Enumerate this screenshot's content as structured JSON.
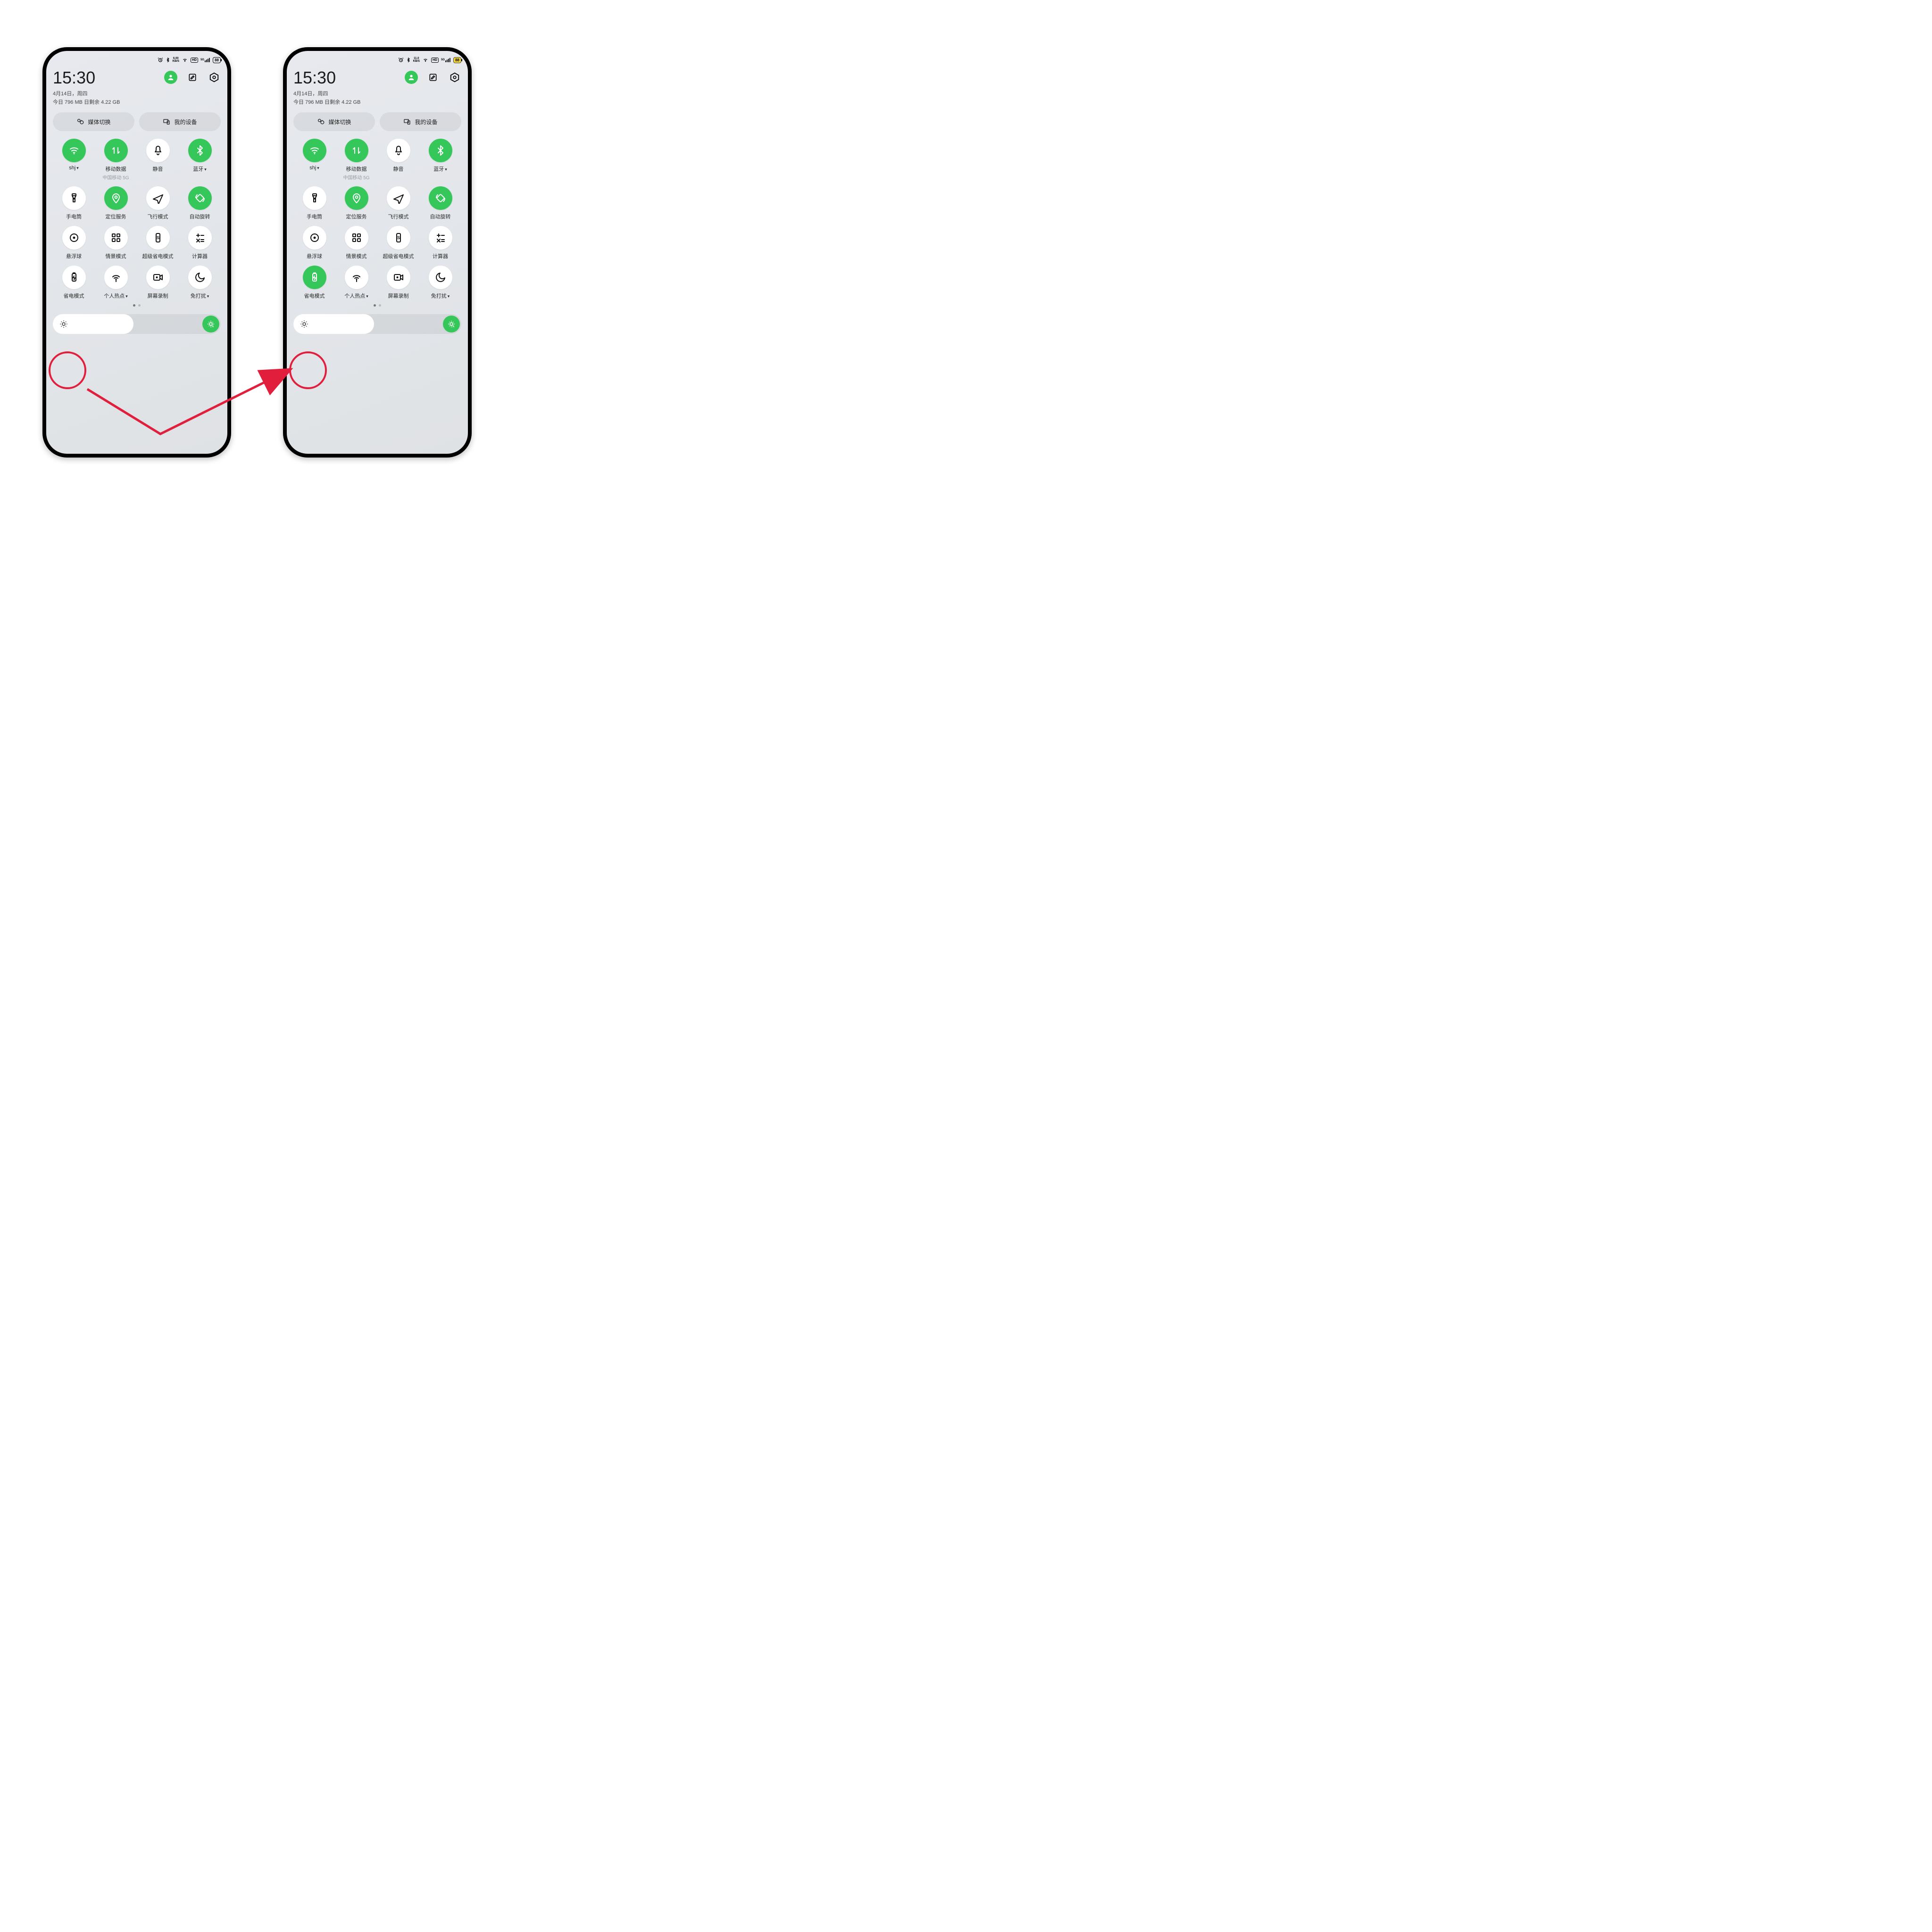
{
  "colors": {
    "accent": "#35c759",
    "annotation": "#e11e3c"
  },
  "status": {
    "kbs_left": {
      "top": "6.00",
      "bottom": "KB/S"
    },
    "kbs_right": {
      "top": "11.0",
      "bottom": "KB/S"
    },
    "hd": "HD",
    "net": "5G",
    "batt_left": "88",
    "batt_right": "88"
  },
  "header": {
    "time": "15:30",
    "date": "4月14日，周四",
    "usage": "今日 796 MB 日剩余 4.22 GB"
  },
  "pills": {
    "media": "媒体切换",
    "devices": "我的设备"
  },
  "carrier": "中国移动 5G",
  "tiles": [
    {
      "key": "wifi",
      "label": "shj",
      "on": true,
      "caret": true
    },
    {
      "key": "mobiledata",
      "label": "移动数据",
      "on": true,
      "caret": false
    },
    {
      "key": "mute",
      "label": "静音",
      "on": false,
      "caret": false
    },
    {
      "key": "bluetooth",
      "label": "蓝牙",
      "on": true,
      "caret": true
    },
    {
      "key": "flashlight",
      "label": "手电筒",
      "on": false,
      "caret": false
    },
    {
      "key": "location",
      "label": "定位服务",
      "on": true,
      "caret": false
    },
    {
      "key": "airplane",
      "label": "飞行模式",
      "on": false,
      "caret": false
    },
    {
      "key": "autorotate",
      "label": "自动旋转",
      "on": true,
      "caret": false
    },
    {
      "key": "floatball",
      "label": "悬浮球",
      "on": false,
      "caret": false
    },
    {
      "key": "scene",
      "label": "情景模式",
      "on": false,
      "caret": false
    },
    {
      "key": "ultrasaver",
      "label": "超级省电模式",
      "on": false,
      "caret": false
    },
    {
      "key": "calculator",
      "label": "计算器",
      "on": false,
      "caret": false
    },
    {
      "key": "saver",
      "label": "省电模式",
      "on": false,
      "caret": false
    },
    {
      "key": "hotspot",
      "label": "个人热点",
      "on": false,
      "caret": true
    },
    {
      "key": "screenrec",
      "label": "屏幕录制",
      "on": false,
      "caret": false
    },
    {
      "key": "dnd",
      "label": "免打扰",
      "on": false,
      "caret": true
    }
  ],
  "right_overrides": {
    "saver_on": true
  }
}
